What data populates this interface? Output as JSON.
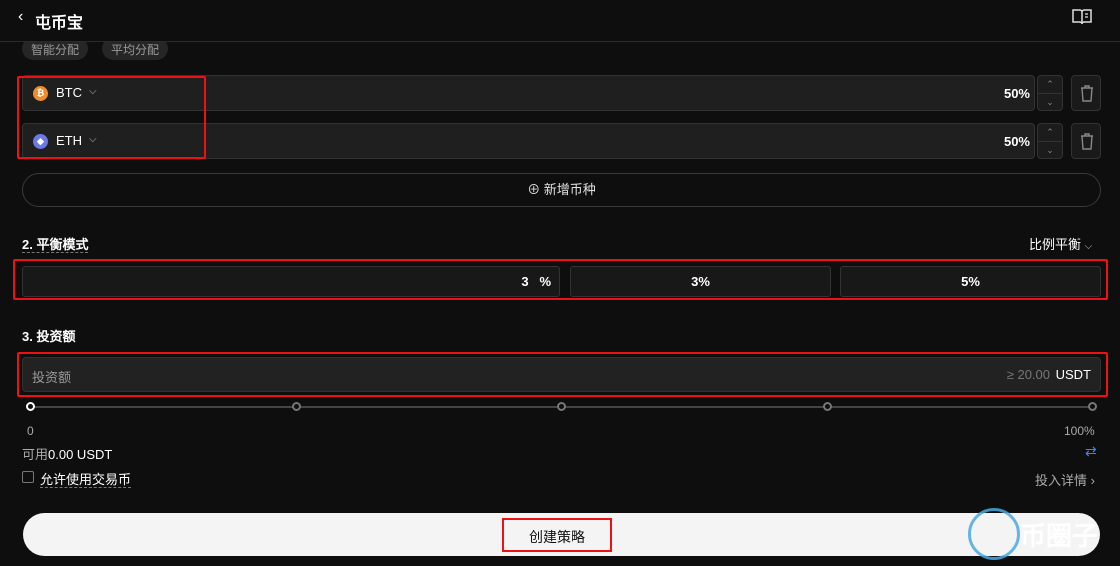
{
  "header": {
    "back_icon": "chevron-left-icon",
    "title": "屯币宝",
    "book_icon": "book-icon"
  },
  "alloc_tabs": [
    "智能分配",
    "平均分配"
  ],
  "coins": [
    {
      "name": "BTC",
      "icon_text": "₿",
      "color": "#f28b2c",
      "percent": "50%"
    },
    {
      "name": "ETH",
      "icon_text": "◆",
      "color": "#6a79e8",
      "percent": "50%"
    }
  ],
  "add_coin_label": "⊕ 新增币种",
  "balance": {
    "section_label": "2. 平衡模式",
    "mode": "比例平衡",
    "input_value": "3",
    "unit": "%",
    "presets": [
      "3%",
      "5%"
    ]
  },
  "investment": {
    "section_label": "3. 投资额",
    "placeholder": "投资额",
    "min_hint": "≥ 20.00",
    "currency": "USDT",
    "slider_min": "0",
    "slider_max": "100%",
    "slider_value": 0,
    "available_label": "可用",
    "available_value": "0.00 USDT",
    "allow_trading_coins": "允许使用交易币",
    "details_link": "投入详情",
    "swap_icon": "swap-icon"
  },
  "create_button": "创建策略",
  "watermark": "币圈子",
  "colors": {
    "highlight": "#e11111",
    "accent": "#3b82f6"
  }
}
